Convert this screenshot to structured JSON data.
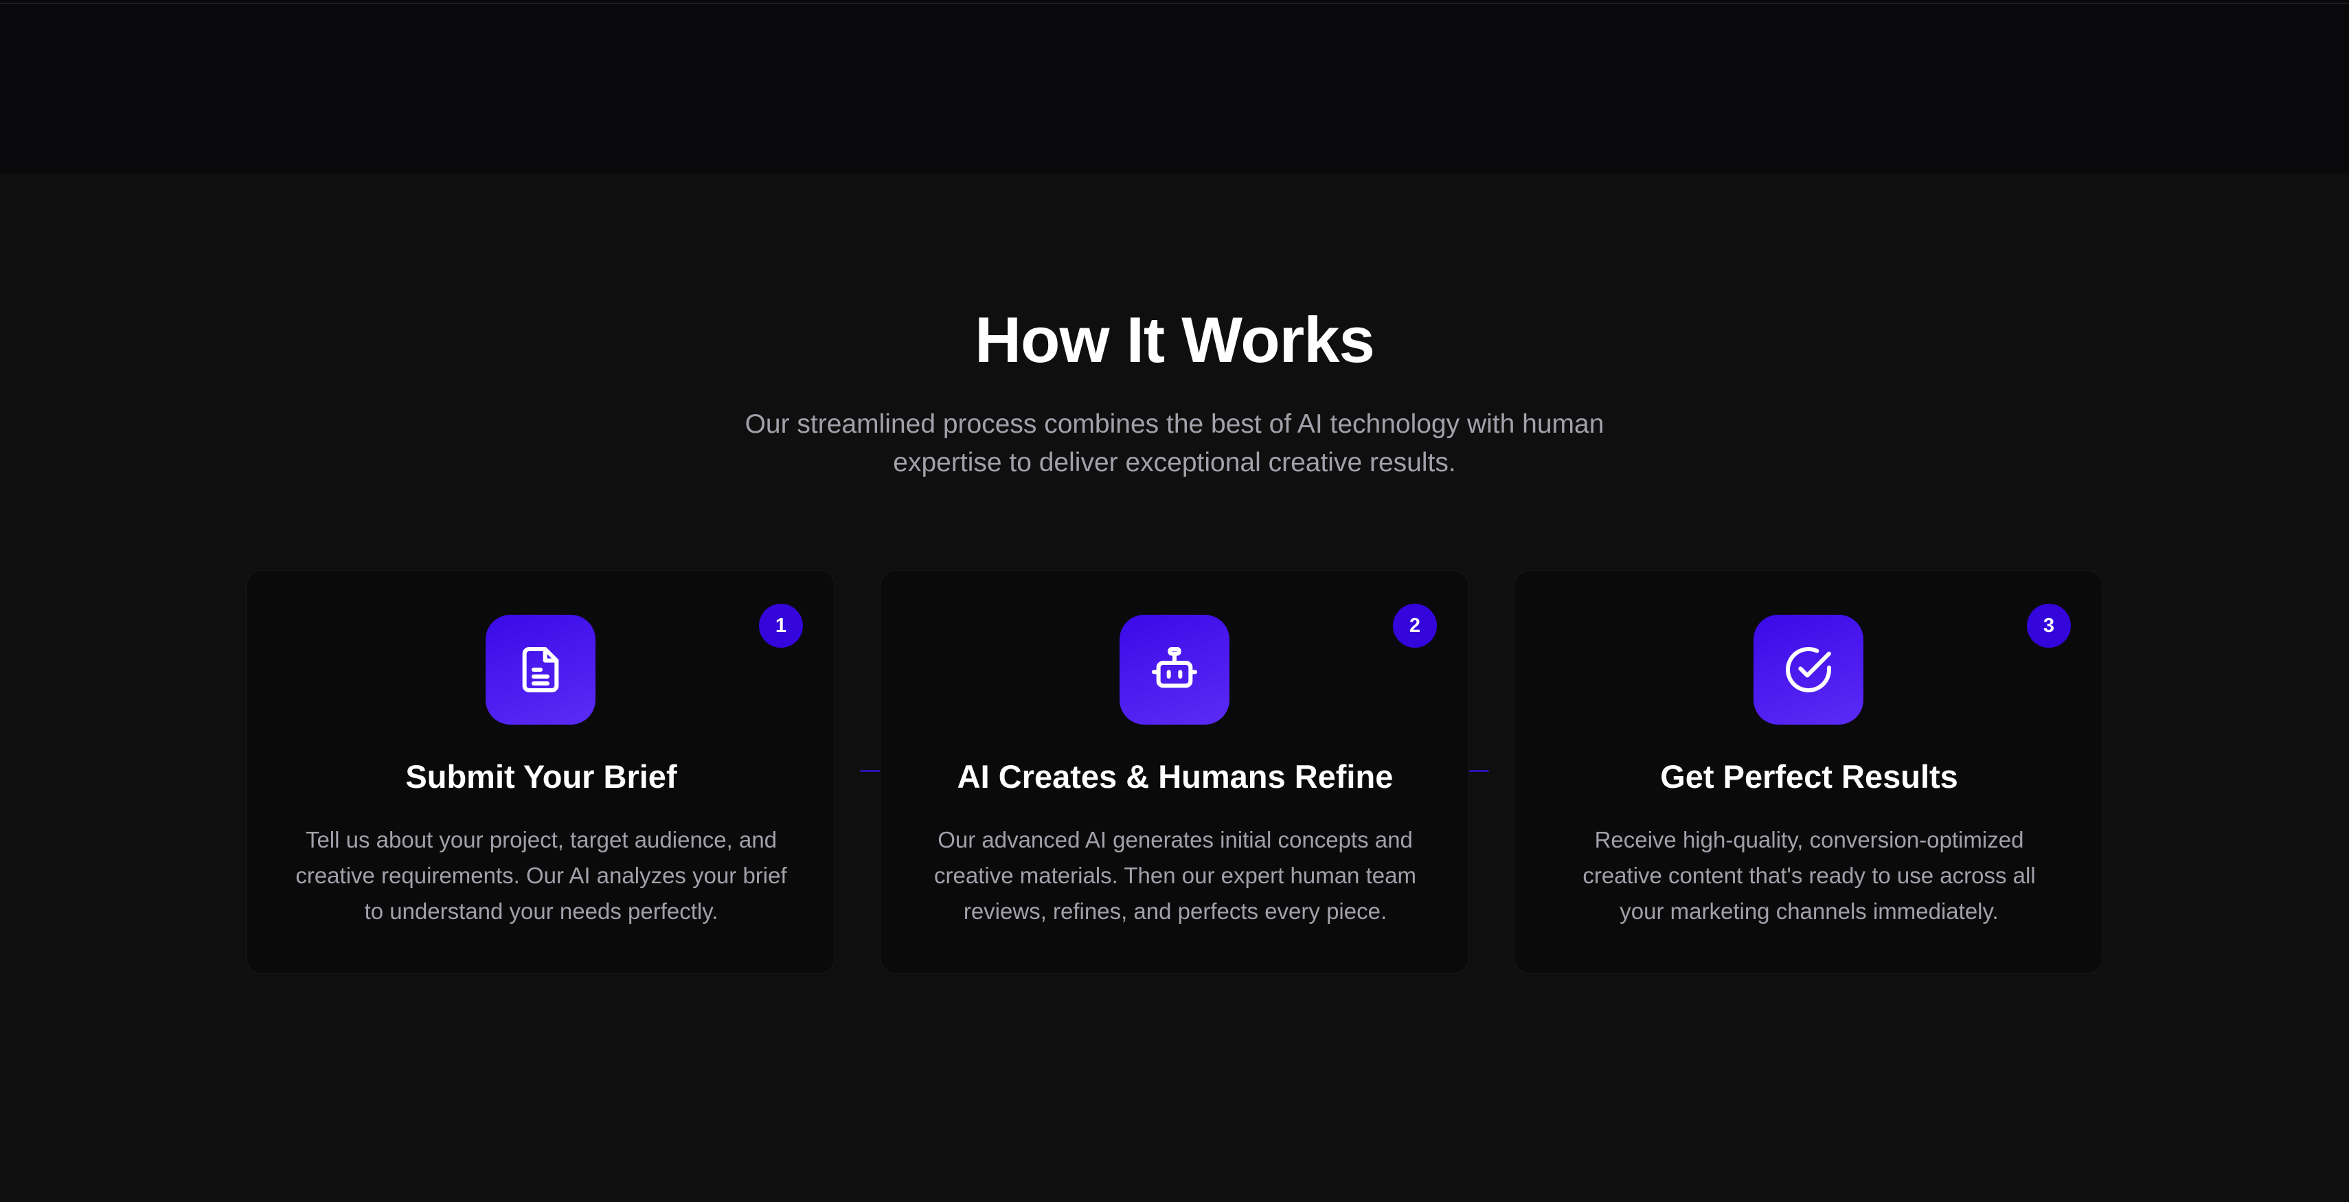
{
  "section": {
    "title": "How It Works",
    "subtitle": "Our streamlined process combines the best of AI technology with human expertise to deliver exceptional creative results."
  },
  "steps": [
    {
      "number": "1",
      "icon": "document-icon",
      "title": "Submit Your Brief",
      "description": "Tell us about your project, target audience, and creative requirements. Our AI analyzes your brief to understand your needs perfectly."
    },
    {
      "number": "2",
      "icon": "robot-icon",
      "title": "AI Creates & Humans Refine",
      "description": "Our advanced AI generates initial concepts and creative materials. Then our expert human team reviews, refines, and perfects every piece."
    },
    {
      "number": "3",
      "icon": "check-circle-icon",
      "title": "Get Perfect Results",
      "description": "Receive high-quality, conversion-optimized creative content that's ready to use across all your marketing channels immediately."
    }
  ],
  "colors": {
    "page_background": "#0f0f10",
    "card_background": "#0a0a0b",
    "accent": "#3406dc",
    "accent_gradient_end": "#5b2bf5",
    "heading_text": "#ffffff",
    "body_text": "#a1a1aa"
  }
}
